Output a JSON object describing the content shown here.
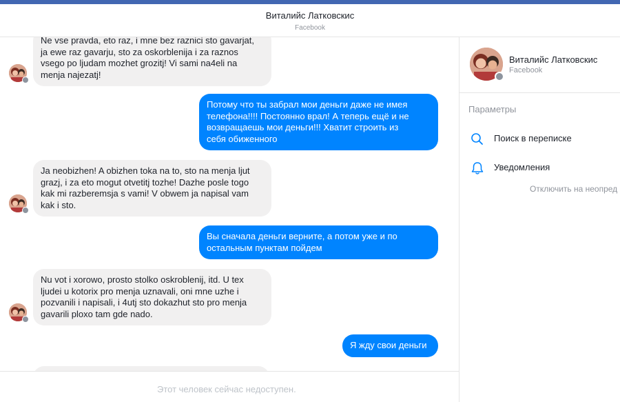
{
  "header": {
    "contact_name": "Виталийс Латковскис",
    "network": "Facebook"
  },
  "messages": [
    {
      "direction": "in",
      "lines": [
        "Ne vse pravda, eto raz, i mne bez raznici sto gavarjat,",
        "ja ewe raz gavarju, sto za oskorblenija i za raznos",
        "vsego po ljudam mozhet grozitj! Vi sami na4eli na",
        "menja najezatj!"
      ]
    },
    {
      "direction": "out",
      "lines": [
        "Потому что ты забрал мои деньги даже не имея",
        "телефона!!!!  Постоянно врал!  А теперь ещё и не",
        "возвращаешь мои деньги!!!  Хватит строить из",
        "себя обиженного"
      ]
    },
    {
      "direction": "in",
      "lines": [
        "Ja neobizhen! A obizhen toka na to, sto na menja ljut",
        "grazj, i za eto mogut otvetitj tozhe! Dazhe posle togo",
        "kak mi razberemsja s vami! V obwem ja napisal vam",
        "kak i sto."
      ]
    },
    {
      "direction": "out",
      "lines": [
        "Вы сначала деньги верните, а потом уже и по",
        "остальным пунктам пойдем"
      ]
    },
    {
      "direction": "in",
      "lines": [
        "Nu vot i xorowo, prosto stolko oskroblenij, itd. U tex",
        "ljudei u kotorix pro menja uznavali, oni mne uzhe i",
        "pozvanili i napisali, i 4utj sto dokazhut sto pro menja",
        "gavarili ploxo tam gde nado."
      ]
    },
    {
      "direction": "out",
      "lines": [
        "Я жду свои деньги"
      ]
    }
  ],
  "footer": {
    "status_text": "Этот человек сейчас недоступен."
  },
  "sidebar": {
    "contact_name": "Виталийс Латковскис",
    "network": "Facebook",
    "section_title": "Параметры",
    "search_label": "Поиск в переписке",
    "search_icon": "search-icon",
    "notifications_label": "Уведомления",
    "notifications_icon": "bell-icon",
    "mute_hint": "Отключить на неопред"
  },
  "colors": {
    "accent": "#0084ff",
    "incoming_bubble": "#f1f0f0",
    "top_bar": "#4267b2"
  }
}
